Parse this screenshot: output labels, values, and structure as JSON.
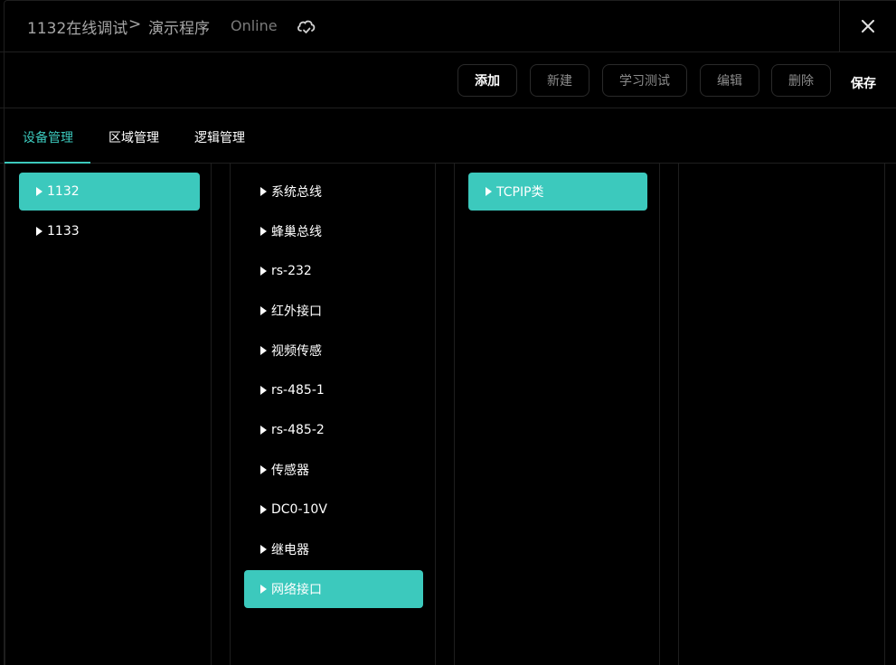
{
  "header": {
    "title": "1132在线调试",
    "breadcrumb_separator": ">",
    "subtitle": "演示程序",
    "status": "Online"
  },
  "toolbar": {
    "buttons": [
      {
        "label": "添加",
        "active": true
      },
      {
        "label": "新建",
        "active": false
      },
      {
        "label": "学习测试",
        "active": false
      },
      {
        "label": "编辑",
        "active": false
      },
      {
        "label": "删除",
        "active": false
      }
    ],
    "save_label": "保存"
  },
  "tabs": [
    {
      "label": "设备管理",
      "active": true
    },
    {
      "label": "区域管理",
      "active": false
    },
    {
      "label": "逻辑管理",
      "active": false
    }
  ],
  "columns": {
    "devices": [
      "1132",
      "1133"
    ],
    "interfaces": [
      "系统总线",
      "蜂巢总线",
      "rs-232",
      "红外接口",
      "视频传感",
      "rs-485-1",
      "rs-485-2",
      "传感器",
      "DC0-10V",
      "继电器",
      "网络接口"
    ],
    "types": [
      "TCPIP类"
    ]
  },
  "colors": {
    "accent": "#3cc9bd",
    "background": "#000000",
    "border": "#1f1f1f",
    "muted_text": "#a6a6a6"
  }
}
